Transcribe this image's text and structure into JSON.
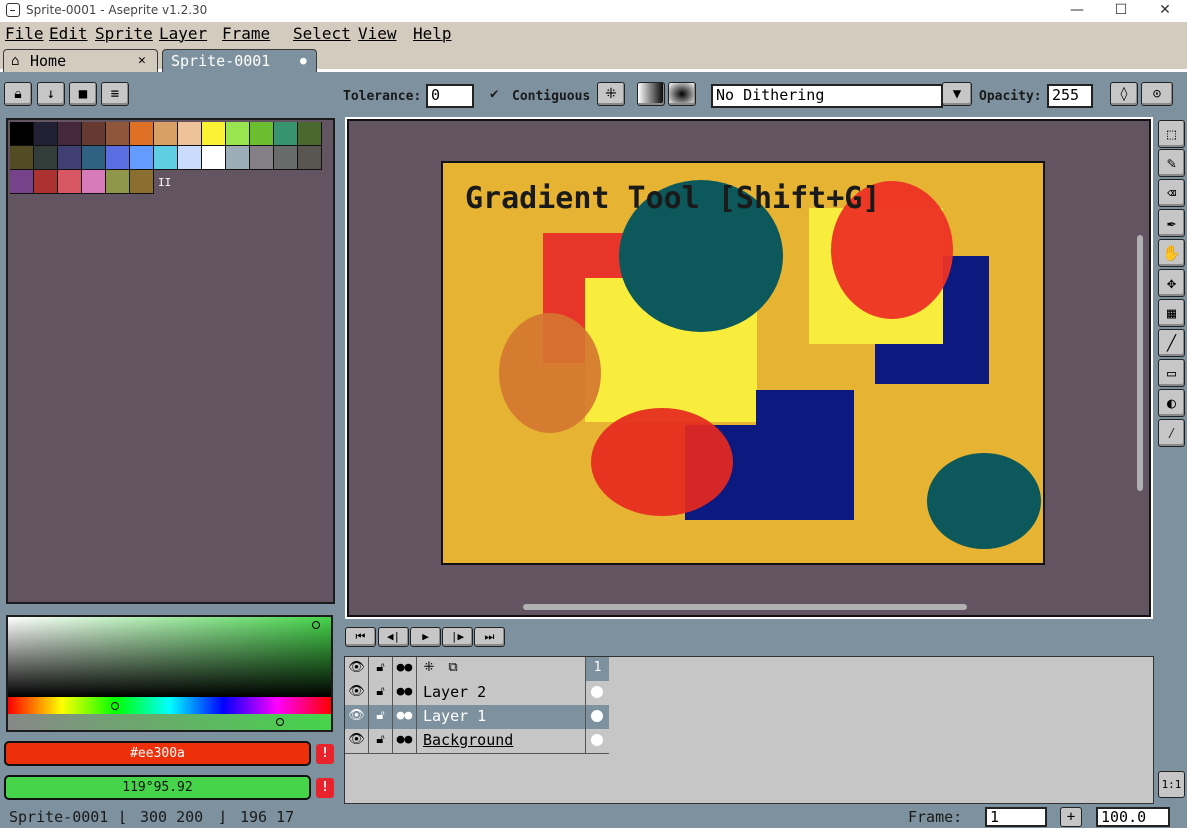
{
  "window": {
    "title": "Sprite-0001 - Aseprite v1.2.30",
    "minimize": "—",
    "maximize": "☐",
    "close": "✕"
  },
  "menu": [
    "File",
    "Edit",
    "Sprite",
    "Layer",
    "Frame",
    "Select",
    "View",
    "Help"
  ],
  "tabs": [
    {
      "label": "Home",
      "close": "✕",
      "icon": "home-icon"
    },
    {
      "label": "Sprite-0001",
      "close": "●"
    }
  ],
  "toolbar": {
    "tolerance_label": "Tolerance:",
    "tolerance_value": "0",
    "contiguous_label": "Contiguous",
    "contiguous_checked": true,
    "dithering_value": "No Dithering",
    "opacity_label": "Opacity:",
    "opacity_value": "255"
  },
  "palette": {
    "colors": [
      "#000000",
      "#222034",
      "#45283c",
      "#663931",
      "#8f563b",
      "#df7126",
      "#d9a066",
      "#eec39a",
      "#fbf236",
      "#99e550",
      "#6abe30",
      "#37946e",
      "#4b692f",
      "#524b24",
      "#323c39",
      "#3f3f74",
      "#306082",
      "#5b6ee1",
      "#639bff",
      "#5fcde4",
      "#cbdbfc",
      "#ffffff",
      "#9badb7",
      "#847e87",
      "#696a6a",
      "#595652",
      "#76428a",
      "#ac3232",
      "#d95763",
      "#d77bba",
      "#8f974a",
      "#8a6f30"
    ],
    "marker": "II"
  },
  "canvas": {
    "text": "Gradient Tool [Shift+G]",
    "background": "#e6b432",
    "bg_color": "#625461"
  },
  "colors": {
    "foreground_label": "#ee300a",
    "foreground_hex": "#ee300a",
    "background_label": "119°95.92",
    "background_hex": "#45d44a",
    "warning": "!"
  },
  "timeline": {
    "frame_header": "1",
    "layers": [
      {
        "name": "Layer 2",
        "selected": false
      },
      {
        "name": "Layer 1",
        "selected": true
      },
      {
        "name": "Background",
        "selected": false
      }
    ]
  },
  "zoom_one_to_one": "1:1",
  "status": {
    "sprite_name": "Sprite-0001",
    "size": "300 200",
    "pos": "196 17",
    "frame_label": "Frame:",
    "frame_value": "1",
    "plus": "+",
    "zoom": "100.0"
  }
}
